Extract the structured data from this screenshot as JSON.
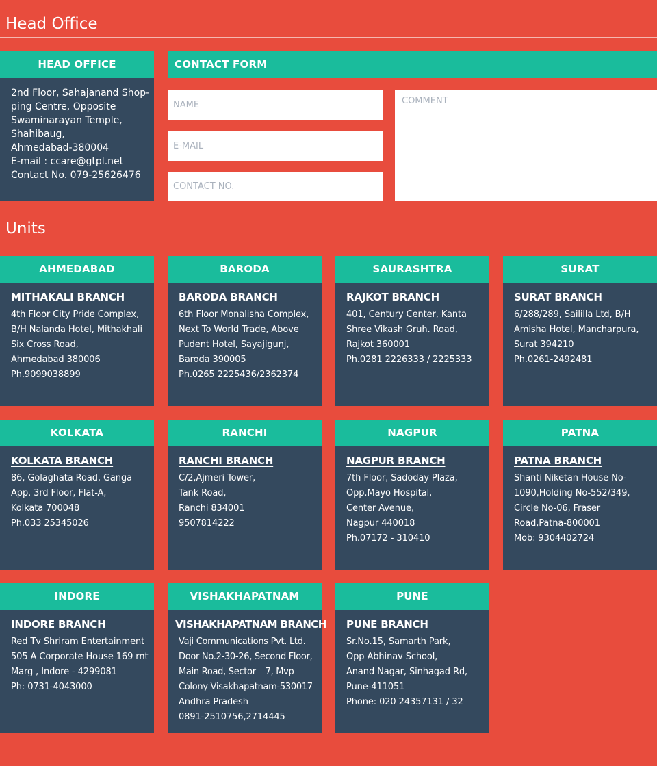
{
  "head_office_section": {
    "title": "Head Office"
  },
  "head_office_card": {
    "heading": "HEAD OFFICE",
    "lines": [
      "2nd Floor, Sahajanand Shop-",
      "ping Centre, Opposite",
      "Swaminarayan Temple,",
      "Shahibaug,",
      "Ahmedabad-380004",
      "E-mail :  ccare@gtpl.net",
      "Contact No. 079-25626476"
    ]
  },
  "contact_form": {
    "heading": "CONTACT FORM",
    "name_placeholder": "NAME",
    "email_placeholder": "E-MAIL",
    "contact_placeholder": "CONTACT NO.",
    "comment_placeholder": "COMMENT"
  },
  "units_section": {
    "title": "Units"
  },
  "units": [
    {
      "city": "AHMEDABAD",
      "branch": "MITHAKALI BRANCH",
      "lines": [
        "4th Floor City Pride Complex,",
        "B/H Nalanda Hotel, Mithakhali",
        "Six Cross Road,",
        "Ahmedabad 380006",
        "Ph.9099038899"
      ]
    },
    {
      "city": "BARODA",
      "branch": "BARODA BRANCH",
      "lines": [
        "6th Floor Monalisha Complex,",
        "Next To World Trade, Above",
        "Pudent Hotel, Sayajigunj,",
        "Baroda 390005",
        "Ph.0265 2225436/2362374"
      ]
    },
    {
      "city": "SAURASHTRA",
      "branch": "RAJKOT BRANCH",
      "lines": [
        "401, Century Center, Kanta",
        "Shree Vikash Gruh. Road,",
        "Rajkot 360001",
        "Ph.0281 2226333 / 2225333"
      ]
    },
    {
      "city": "SURAT",
      "branch": "SURAT BRANCH",
      "lines": [
        "6/288/289, Saililla Ltd, B/H",
        "Amisha Hotel, Mancharpura,",
        "Surat 394210",
        "Ph.0261-2492481"
      ]
    },
    {
      "city": "KOLKATA",
      "branch": "KOLKATA BRANCH",
      "lines": [
        "86, Golaghata Road, Ganga",
        "App. 3rd Floor, Flat-A,",
        "Kolkata 700048",
        "Ph.033 25345026"
      ]
    },
    {
      "city": "RANCHI",
      "branch": "RANCHI BRANCH",
      "lines": [
        "C/2,Ajmeri Tower,",
        "Tank Road,",
        "Ranchi 834001",
        "9507814222"
      ]
    },
    {
      "city": "NAGPUR",
      "branch": "NAGPUR BRANCH",
      "lines": [
        "7th Floor, Sadoday Plaza,",
        "Opp.Mayo Hospital,",
        "Center Avenue,",
        "Nagpur 440018",
        "Ph.07172 - 310410"
      ]
    },
    {
      "city": "PATNA",
      "branch": "PATNA BRANCH",
      "lines": [
        "Shanti Niketan House No-",
        "1090,Holding No-552/349,",
        "Circle No-06, Fraser",
        "Road,Patna-800001",
        "Mob: 9304402724"
      ]
    },
    {
      "city": "INDORE",
      "branch": "INDORE BRANCH",
      "lines": [
        "Red Tv Shriram Entertainment",
        "505 A Corporate House 169 rnt",
        "Marg , Indore - 4299081",
        "Ph: 0731-4043000"
      ]
    },
    {
      "city": "VISHAKHAPATNAM",
      "branch": "VISHAKHAPATNAM BRANCH",
      "lines": [
        "Vaji Communications Pvt. Ltd.",
        "Door No.2-30-26, Second Floor,",
        "Main Road, Sector – 7, Mvp",
        "Colony Visakhapatnam-530017",
        "Andhra Pradesh",
        "0891-2510756,2714445"
      ]
    },
    {
      "city": "PUNE",
      "branch": "PUNE BRANCH",
      "lines": [
        "Sr.No.15, Samarth Park,",
        "Opp Abhinav School,",
        "Anand Nagar, Sinhagad Rd,",
        "Pune-411051",
        "Phone: 020 24357131 / 32"
      ]
    }
  ]
}
